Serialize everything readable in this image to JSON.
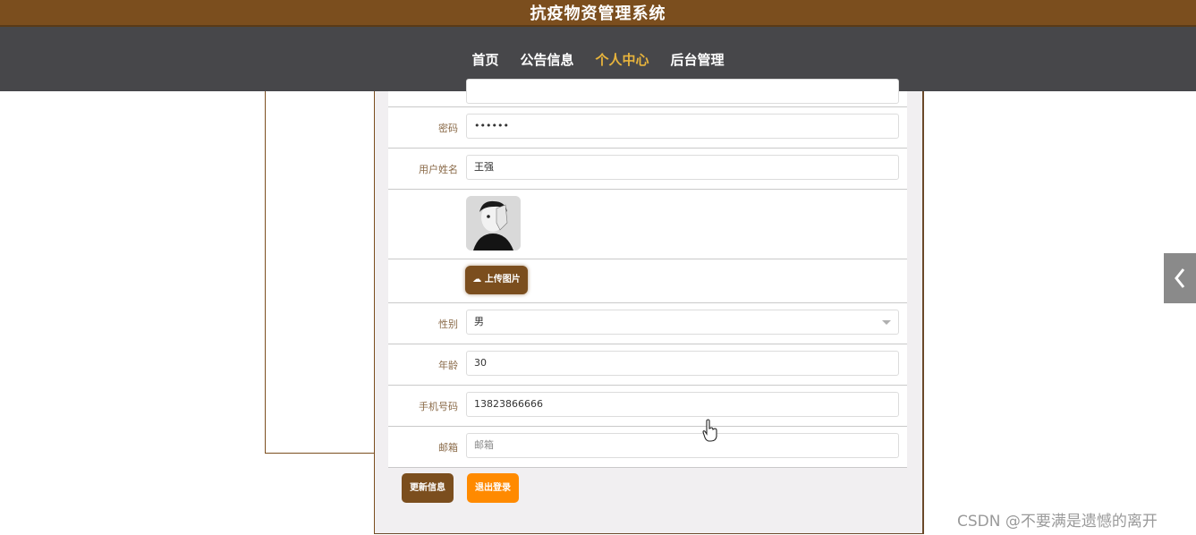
{
  "header": {
    "title": "抗疫物资管理系统"
  },
  "nav": {
    "items": [
      {
        "label": "首页"
      },
      {
        "label": "公告信息"
      },
      {
        "label": "个人中心"
      },
      {
        "label": "后台管理"
      }
    ],
    "active_index": 2
  },
  "form": {
    "password": {
      "label": "密码",
      "value": "••••••"
    },
    "name": {
      "label": "用户姓名",
      "value": "王强"
    },
    "upload_button": {
      "label": "上传图片",
      "icon": "cloud-upload-icon"
    },
    "gender": {
      "label": "性别",
      "value": "男"
    },
    "age": {
      "label": "年龄",
      "value": "30"
    },
    "phone": {
      "label": "手机号码",
      "value": "13823866666"
    },
    "email": {
      "label": "邮箱",
      "placeholder": "邮箱"
    }
  },
  "actions": {
    "update_label": "更新信息",
    "logout_label": "退出登录"
  },
  "watermark": "CSDN @不要满是遗憾的离开",
  "colors": {
    "brand": "#7b4e1e",
    "nav_bg": "#47474a",
    "nav_active": "#e8b43c",
    "logout": "#ff8a00"
  }
}
